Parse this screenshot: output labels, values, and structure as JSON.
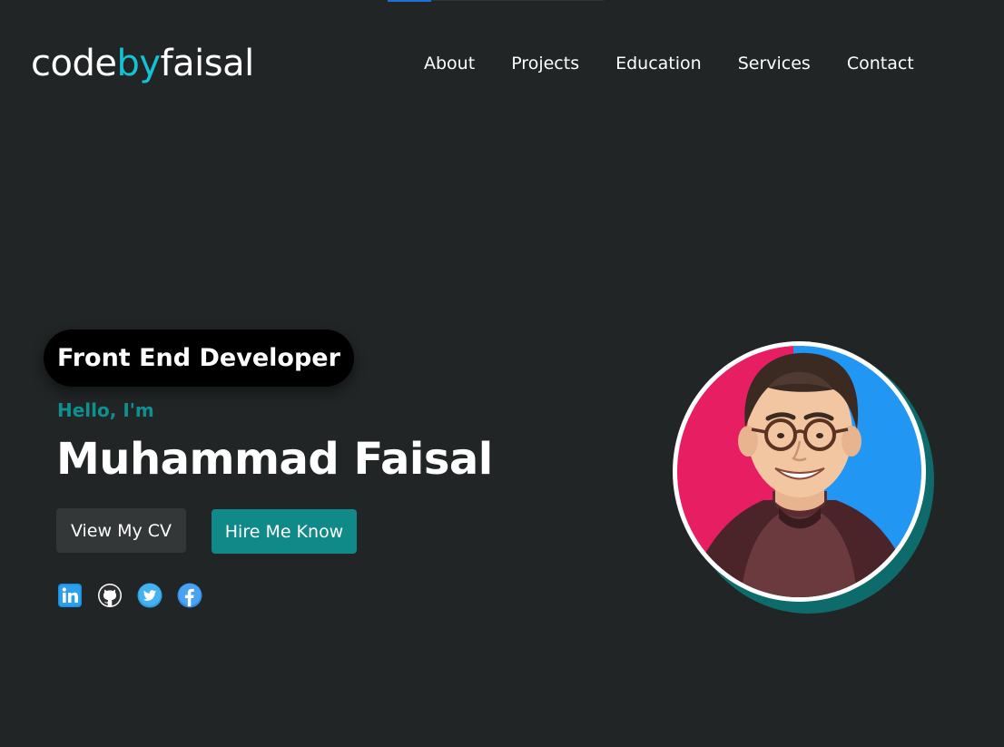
{
  "logo": {
    "part1": "code",
    "part2": "by",
    "part3": "faisal"
  },
  "nav": {
    "items": [
      "About",
      "Projects",
      "Education",
      "Services",
      "Contact"
    ]
  },
  "hero": {
    "role": "Front End Developer",
    "greeting": "Hello, I'm",
    "name": "Muhammad Faisal",
    "cv_button": "View My CV",
    "hire_button": "Hire Me Know"
  },
  "socials": [
    {
      "icon": "linkedin-icon"
    },
    {
      "icon": "github-icon"
    },
    {
      "icon": "twitter-icon"
    },
    {
      "icon": "facebook-icon"
    }
  ],
  "colors": {
    "background": "#212526",
    "accent": "#14c2d3",
    "teal": "#0f8a88",
    "pill": "#000000"
  }
}
